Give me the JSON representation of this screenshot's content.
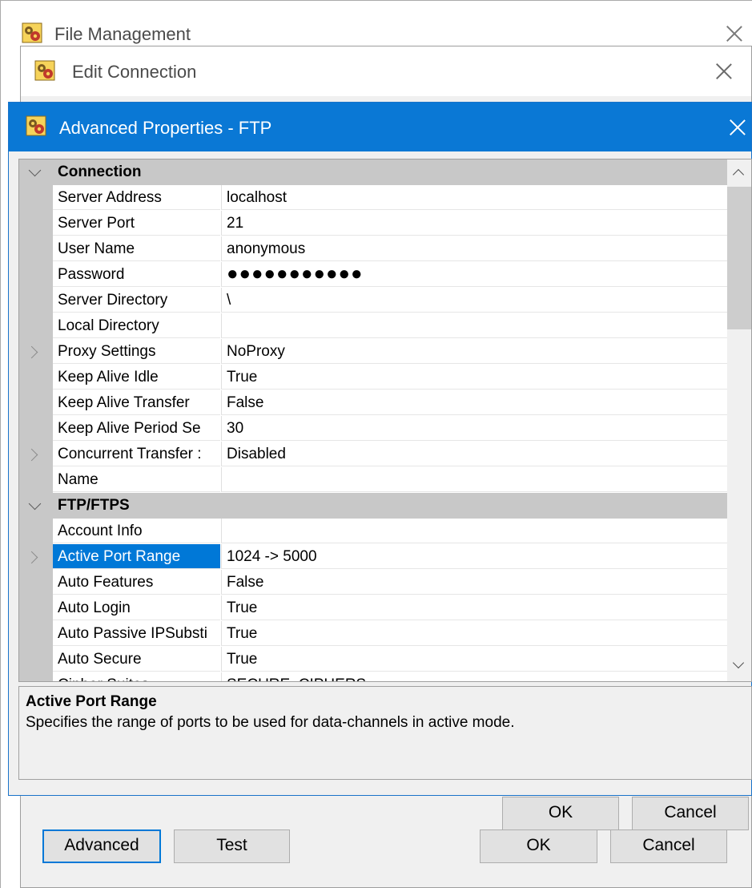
{
  "file_management": {
    "title": "File Management"
  },
  "edit_connection": {
    "title": "Edit Connection",
    "buttons": {
      "advanced": "Advanced",
      "test": "Test",
      "ok": "OK",
      "cancel": "Cancel"
    }
  },
  "advanced_properties": {
    "title": "Advanced Properties - FTP",
    "grid": {
      "rows": [
        {
          "kind": "category",
          "name": "Connection",
          "expanded": true
        },
        {
          "kind": "property",
          "name": "Server Address",
          "value": "localhost"
        },
        {
          "kind": "property",
          "name": "Server Port",
          "value": "21"
        },
        {
          "kind": "property",
          "name": "User Name",
          "value": "anonymous"
        },
        {
          "kind": "property",
          "name": "Password",
          "value": "●●●●●●●●●●●",
          "password": true
        },
        {
          "kind": "property",
          "name": "Server Directory",
          "value": "\\"
        },
        {
          "kind": "property",
          "name": "Local Directory",
          "value": ""
        },
        {
          "kind": "property",
          "name": "Proxy Settings",
          "value": "NoProxy",
          "expandable": true
        },
        {
          "kind": "property",
          "name": "Keep Alive Idle",
          "value": "True"
        },
        {
          "kind": "property",
          "name": "Keep Alive Transfer",
          "value": "False"
        },
        {
          "kind": "property",
          "name": "Keep Alive Period Se",
          "value": "30"
        },
        {
          "kind": "property",
          "name": "Concurrent Transfer :",
          "value": "Disabled",
          "expandable": true
        },
        {
          "kind": "property",
          "name": "Name",
          "value": ""
        },
        {
          "kind": "category",
          "name": "FTP/FTPS",
          "expanded": true
        },
        {
          "kind": "property",
          "name": "Account Info",
          "value": ""
        },
        {
          "kind": "property",
          "name": "Active Port Range",
          "value": "1024 -> 5000",
          "expandable": true,
          "selected": true
        },
        {
          "kind": "property",
          "name": "Auto Features",
          "value": "False"
        },
        {
          "kind": "property",
          "name": "Auto Login",
          "value": "True"
        },
        {
          "kind": "property",
          "name": "Auto Passive IPSubsti",
          "value": "True"
        },
        {
          "kind": "property",
          "name": "Auto Secure",
          "value": "True"
        },
        {
          "kind": "property",
          "name": "Cipher Suites",
          "value": "SECURE_CIPHERS"
        }
      ]
    },
    "description": {
      "title": "Active Port Range",
      "text": "Specifies the range of ports to be used for data-channels in active mode."
    },
    "buttons": {
      "ok": "OK",
      "cancel": "Cancel"
    }
  }
}
